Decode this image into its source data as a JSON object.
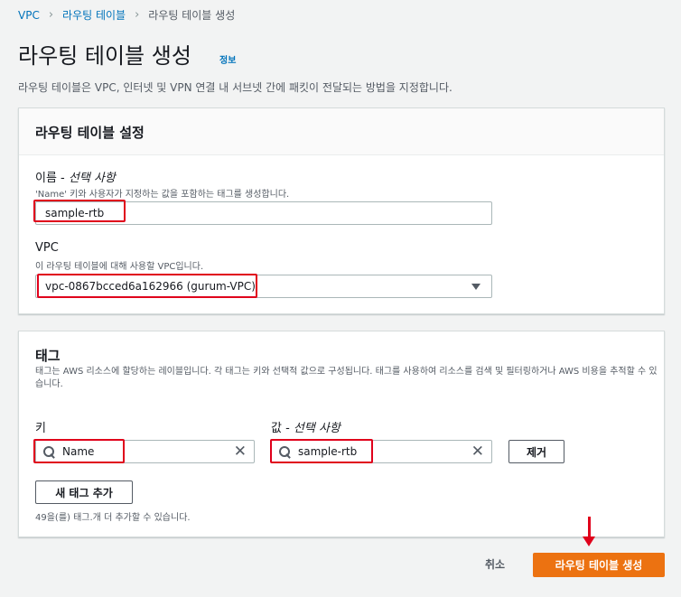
{
  "breadcrumb": {
    "items": [
      "VPC",
      "라우팅 테이블",
      "라우팅 테이블 생성"
    ]
  },
  "page": {
    "title": "라우팅 테이블 생성",
    "info_label": "정보",
    "description": "라우팅 테이블은 VPC, 인터넷 및 VPN 연결 내 서브넷 간에 패킷이 전달되는 방법을 지정합니다."
  },
  "settings": {
    "title": "라우팅 테이블 설정",
    "name_label": "이름 - ",
    "name_optional": "선택 사항",
    "name_desc": "'Name' 키와 사용자가 지정하는 값을 포함하는 태그를 생성합니다.",
    "name_value": "sample-rtb",
    "vpc_label": "VPC",
    "vpc_desc": "이 라우팅 테이블에 대해 사용할 VPC입니다.",
    "vpc_value": "vpc-0867bcced6a162966 (gurum-VPC)"
  },
  "tags": {
    "title": "태그",
    "description": "태그는 AWS 리소스에 할당하는 레이블입니다. 각 태그는 키와 선택적 값으로 구성됩니다. 태그를 사용하여 리소스를 검색 및 필터링하거나 AWS 비용을 추적할 수 있습니다.",
    "key_label": "키",
    "value_label": "값 - ",
    "value_optional": "선택 사항",
    "key_value": "Name",
    "value_value": "sample-rtb",
    "remove_label": "제거",
    "add_label": "새 태그 추가",
    "remaining_text": "49을(를) 태그.개 더 추가할 수 있습니다."
  },
  "footer": {
    "cancel_label": "취소",
    "create_label": "라우팅 테이블 생성"
  },
  "colors": {
    "primary": "#ec7211",
    "link": "#0073bb",
    "highlight": "#e0001b"
  },
  "icons": [
    "chevron-right-icon",
    "search-icon",
    "close-icon",
    "caret-down-icon",
    "arrow-down-icon"
  ]
}
